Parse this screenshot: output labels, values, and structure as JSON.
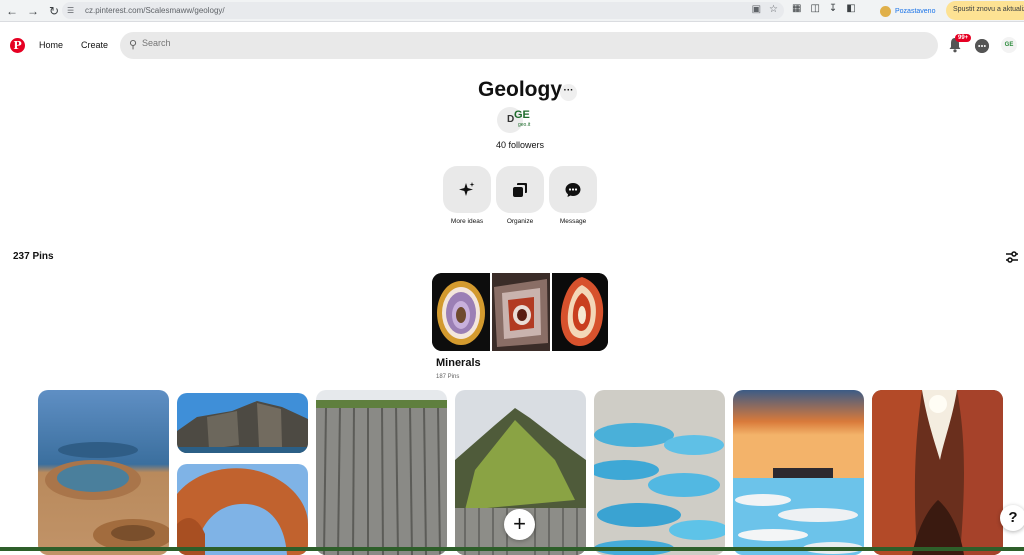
{
  "browser": {
    "url": "cz.pinterest.com/Scalesmaww/geology/",
    "profile_label": "Pozastaveno",
    "update_label": "Spustit znovu a aktualizovat"
  },
  "header": {
    "logo": "P",
    "nav_home": "Home",
    "nav_create": "Create",
    "search_placeholder": "Search",
    "notifications_badge": "99+",
    "avatar_label": "GE"
  },
  "board": {
    "title": "Geology",
    "more_label": "···",
    "owner_initial": "D",
    "owner_logo": "GE",
    "owner_logo_sub": "geo.it",
    "followers": "40 followers",
    "actions": [
      {
        "label": "More ideas",
        "icon": "sparkle-icon"
      },
      {
        "label": "Organize",
        "icon": "organize-icon"
      },
      {
        "label": "Message",
        "icon": "message-icon"
      }
    ]
  },
  "pins_header": {
    "count": "237 Pins"
  },
  "section": {
    "title": "Minerals",
    "count": "187 Pins"
  },
  "colors": {
    "brand": "#e60023",
    "search_bg": "#e9e9e9",
    "action_bg": "#e9e9e9"
  },
  "help_label": "?",
  "plus_label": "+"
}
